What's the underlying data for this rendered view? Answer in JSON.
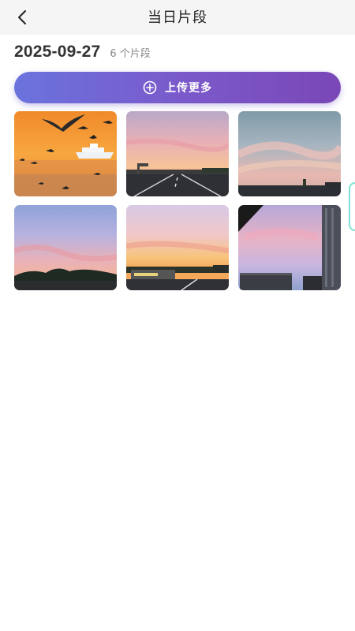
{
  "header": {
    "title": "当日片段"
  },
  "summary": {
    "date": "2025-09-27",
    "count_text": "6 个片段"
  },
  "actions": {
    "upload_label": "上传更多"
  },
  "clips": [
    {
      "scene": "seagulls-and-ferry-at-sunset"
    },
    {
      "scene": "highway-sunset-sky"
    },
    {
      "scene": "pastel-clouds-over-city"
    },
    {
      "scene": "dusk-sky-over-treeline"
    },
    {
      "scene": "highway-sunset-orange"
    },
    {
      "scene": "pink-clouds-near-tower"
    }
  ],
  "colors": {
    "header_bg": "#f5f5f5",
    "accent_gradient_start": "#6b73dd",
    "accent_gradient_end": "#7a47b6",
    "side_tab_border": "#7fe0d4"
  }
}
